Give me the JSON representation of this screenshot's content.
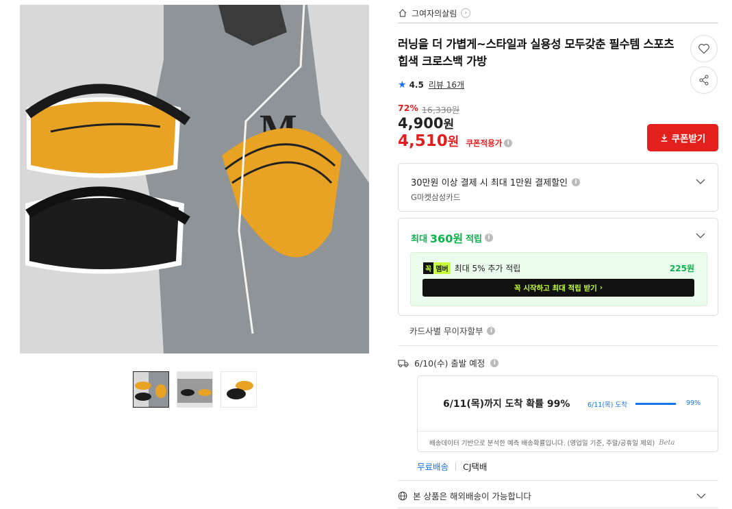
{
  "product_images": {
    "main_alt": "gray sweatshirt with yellow and black waist bags",
    "thumbnails": [
      "thumb-1",
      "thumb-2",
      "thumb-3"
    ]
  },
  "shop": {
    "name": "그여자의살림"
  },
  "product": {
    "title": "러닝을 더 가볍게~스타일과 실용성 모두갖춘 필수템 스포츠힙색 크로스백 가방",
    "rating": "4.5",
    "review_label": "리뷰 16개",
    "discount_rate": "72%",
    "original_price": "16,330원",
    "price_value": "4,900",
    "price_unit": "원",
    "coupon_price_value": "4,510",
    "coupon_price_unit": "원",
    "coupon_tag": "쿠폰적용가",
    "coupon_button": "쿠폰받기"
  },
  "card_discount": {
    "title": "30만원 이상 결제 시 최대 1만원 결제할인",
    "subtitle": "G마켓삼성카드"
  },
  "points": {
    "prefix": "최대",
    "amount": "360원",
    "suffix": "적립",
    "member_badge_a": "꼭",
    "member_badge_b": "멤버",
    "member_text": "최대 5% 추가 적립",
    "member_amount": "225원",
    "member_button": "꼭 시작하고 최대 적립 받기"
  },
  "installment": {
    "label": "카드사별 무이자할부"
  },
  "shipping": {
    "departure": "6/10(수) 출발 예정",
    "arrival_prob": "6/11(목)까지 도착 확률 99%",
    "mini_label": "6/11(목) 도착",
    "mini_pct": "99%",
    "progress_pct": 99,
    "note": "배송데이터 기반으로 분석한 예측 배송확률입니다. (영업일 기준, 주말/공휴일 제외)",
    "note_sig": "Beta",
    "free": "무료배송",
    "carrier": "CJ택배",
    "overseas": "본 상품은 해외배송이 가능합니다"
  },
  "colors": {
    "accent_red": "#e3201b",
    "accent_green": "#0ab24b",
    "accent_blue": "#1a73e8",
    "member_lime": "#c7ff3d"
  }
}
